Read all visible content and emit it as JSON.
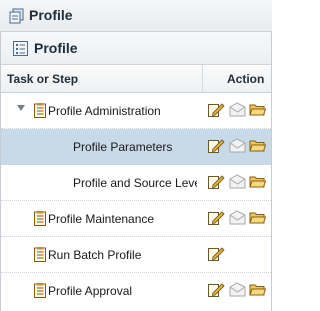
{
  "header": {
    "title": "Profile",
    "icon": "profile-icon"
  },
  "panel": {
    "title": "Profile",
    "icon": "profile-list-icon"
  },
  "table": {
    "col_task": "Task or Step",
    "col_action": "Action"
  },
  "rows": [
    {
      "label": "Profile Administration",
      "expanded": true,
      "selected": false,
      "actions": [
        "edit",
        "view",
        "open"
      ]
    },
    {
      "label": "Profile Parameters",
      "selected": true,
      "actions": [
        "edit",
        "view",
        "open"
      ]
    },
    {
      "label": "Profile and Source Leve",
      "selected": false,
      "actions": [
        "edit",
        "view",
        "open"
      ]
    },
    {
      "label": "Profile Maintenance",
      "selected": false,
      "actions": [
        "edit",
        "view",
        "open"
      ]
    },
    {
      "label": "Run Batch Profile",
      "selected": false,
      "actions": [
        "edit"
      ]
    },
    {
      "label": "Profile Approval",
      "selected": false,
      "actions": [
        "edit",
        "view",
        "open"
      ]
    }
  ]
}
